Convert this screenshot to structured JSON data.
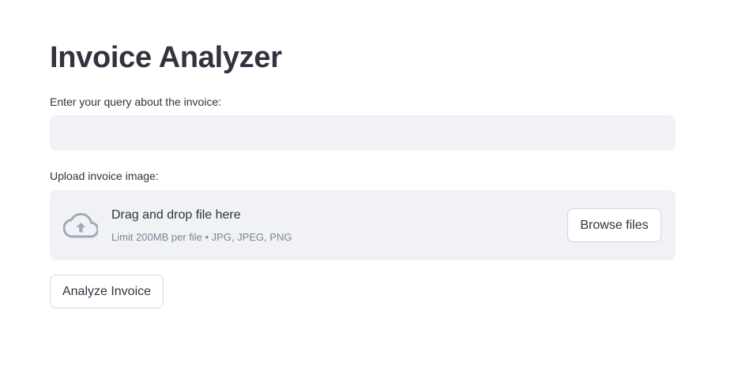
{
  "app": {
    "title": "Invoice Analyzer"
  },
  "query": {
    "label": "Enter your query about the invoice:",
    "value": "",
    "placeholder": ""
  },
  "upload": {
    "label": "Upload invoice image:",
    "icon": "cloud-upload-icon",
    "dropzone_title": "Drag and drop file here",
    "dropzone_subtitle": "Limit 200MB per file • JPG, JPEG, PNG",
    "browse_label": "Browse files"
  },
  "actions": {
    "analyze_label": "Analyze Invoice"
  },
  "colors": {
    "text": "#31333f",
    "muted": "#808495",
    "input_bg": "#f0f2f6",
    "icon": "#a3a8b8",
    "button_border": "#d5d7de"
  }
}
